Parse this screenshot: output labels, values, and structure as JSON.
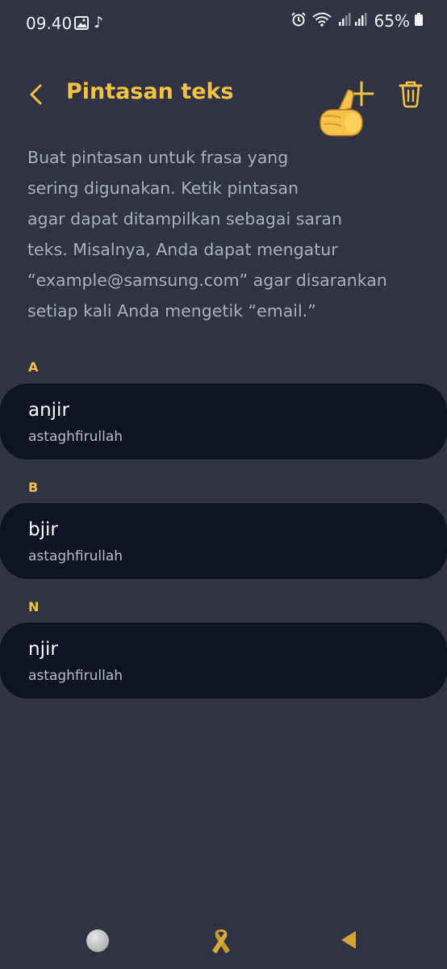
{
  "status_bar": {
    "time": "09.40",
    "battery": "65%",
    "icons": [
      "gallery-icon",
      "tiktok-icon",
      "alarm-icon",
      "wifi-icon",
      "signal-icon",
      "battery-icon"
    ]
  },
  "header": {
    "title": "Pintasan teks",
    "icons": [
      "back-chevron-icon",
      "plus-icon",
      "trash-icon",
      "thumbs-up-emoji"
    ]
  },
  "description": "Buat pintasan untuk frasa yang\nsering digunakan. Ketik pintasan\nagar dapat ditampilkan sebagai saran\nteks. Misalnya, Anda dapat mengatur\n“example@samsung.com” agar disarankan\nsetiap kali Anda mengetik “email.”",
  "sections": [
    {
      "letter": "A",
      "shortcut": "anjir",
      "phrase": "astaghfirullah"
    },
    {
      "letter": "B",
      "shortcut": "bjir",
      "phrase": "astaghfirullah"
    },
    {
      "letter": "N",
      "shortcut": "njir",
      "phrase": "astaghfirullah"
    }
  ],
  "nav_bar": {
    "icons": [
      "home-icon",
      "ribbon-icon",
      "back-triangle-icon"
    ]
  },
  "colors": {
    "background": "#2f3343",
    "accent": "#f3c144",
    "card": "#0e1326",
    "description_text": "#aab0c4"
  }
}
